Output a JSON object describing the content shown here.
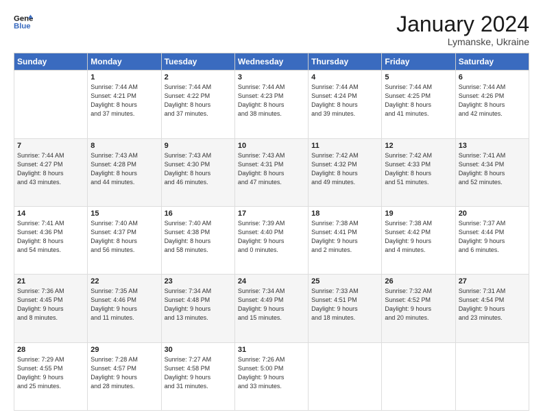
{
  "header": {
    "logo_line1": "General",
    "logo_line2": "Blue",
    "title": "January 2024",
    "subtitle": "Lymanske, Ukraine"
  },
  "calendar": {
    "days_of_week": [
      "Sunday",
      "Monday",
      "Tuesday",
      "Wednesday",
      "Thursday",
      "Friday",
      "Saturday"
    ],
    "weeks": [
      [
        {
          "day": "",
          "sunrise": "",
          "sunset": "",
          "daylight": ""
        },
        {
          "day": "1",
          "sunrise": "Sunrise: 7:44 AM",
          "sunset": "Sunset: 4:21 PM",
          "daylight": "Daylight: 8 hours and 37 minutes."
        },
        {
          "day": "2",
          "sunrise": "Sunrise: 7:44 AM",
          "sunset": "Sunset: 4:22 PM",
          "daylight": "Daylight: 8 hours and 37 minutes."
        },
        {
          "day": "3",
          "sunrise": "Sunrise: 7:44 AM",
          "sunset": "Sunset: 4:23 PM",
          "daylight": "Daylight: 8 hours and 38 minutes."
        },
        {
          "day": "4",
          "sunrise": "Sunrise: 7:44 AM",
          "sunset": "Sunset: 4:24 PM",
          "daylight": "Daylight: 8 hours and 39 minutes."
        },
        {
          "day": "5",
          "sunrise": "Sunrise: 7:44 AM",
          "sunset": "Sunset: 4:25 PM",
          "daylight": "Daylight: 8 hours and 41 minutes."
        },
        {
          "day": "6",
          "sunrise": "Sunrise: 7:44 AM",
          "sunset": "Sunset: 4:26 PM",
          "daylight": "Daylight: 8 hours and 42 minutes."
        }
      ],
      [
        {
          "day": "7",
          "sunrise": "Sunrise: 7:44 AM",
          "sunset": "Sunset: 4:27 PM",
          "daylight": "Daylight: 8 hours and 43 minutes."
        },
        {
          "day": "8",
          "sunrise": "Sunrise: 7:43 AM",
          "sunset": "Sunset: 4:28 PM",
          "daylight": "Daylight: 8 hours and 44 minutes."
        },
        {
          "day": "9",
          "sunrise": "Sunrise: 7:43 AM",
          "sunset": "Sunset: 4:30 PM",
          "daylight": "Daylight: 8 hours and 46 minutes."
        },
        {
          "day": "10",
          "sunrise": "Sunrise: 7:43 AM",
          "sunset": "Sunset: 4:31 PM",
          "daylight": "Daylight: 8 hours and 47 minutes."
        },
        {
          "day": "11",
          "sunrise": "Sunrise: 7:42 AM",
          "sunset": "Sunset: 4:32 PM",
          "daylight": "Daylight: 8 hours and 49 minutes."
        },
        {
          "day": "12",
          "sunrise": "Sunrise: 7:42 AM",
          "sunset": "Sunset: 4:33 PM",
          "daylight": "Daylight: 8 hours and 51 minutes."
        },
        {
          "day": "13",
          "sunrise": "Sunrise: 7:41 AM",
          "sunset": "Sunset: 4:34 PM",
          "daylight": "Daylight: 8 hours and 52 minutes."
        }
      ],
      [
        {
          "day": "14",
          "sunrise": "Sunrise: 7:41 AM",
          "sunset": "Sunset: 4:36 PM",
          "daylight": "Daylight: 8 hours and 54 minutes."
        },
        {
          "day": "15",
          "sunrise": "Sunrise: 7:40 AM",
          "sunset": "Sunset: 4:37 PM",
          "daylight": "Daylight: 8 hours and 56 minutes."
        },
        {
          "day": "16",
          "sunrise": "Sunrise: 7:40 AM",
          "sunset": "Sunset: 4:38 PM",
          "daylight": "Daylight: 8 hours and 58 minutes."
        },
        {
          "day": "17",
          "sunrise": "Sunrise: 7:39 AM",
          "sunset": "Sunset: 4:40 PM",
          "daylight": "Daylight: 9 hours and 0 minutes."
        },
        {
          "day": "18",
          "sunrise": "Sunrise: 7:38 AM",
          "sunset": "Sunset: 4:41 PM",
          "daylight": "Daylight: 9 hours and 2 minutes."
        },
        {
          "day": "19",
          "sunrise": "Sunrise: 7:38 AM",
          "sunset": "Sunset: 4:42 PM",
          "daylight": "Daylight: 9 hours and 4 minutes."
        },
        {
          "day": "20",
          "sunrise": "Sunrise: 7:37 AM",
          "sunset": "Sunset: 4:44 PM",
          "daylight": "Daylight: 9 hours and 6 minutes."
        }
      ],
      [
        {
          "day": "21",
          "sunrise": "Sunrise: 7:36 AM",
          "sunset": "Sunset: 4:45 PM",
          "daylight": "Daylight: 9 hours and 8 minutes."
        },
        {
          "day": "22",
          "sunrise": "Sunrise: 7:35 AM",
          "sunset": "Sunset: 4:46 PM",
          "daylight": "Daylight: 9 hours and 11 minutes."
        },
        {
          "day": "23",
          "sunrise": "Sunrise: 7:34 AM",
          "sunset": "Sunset: 4:48 PM",
          "daylight": "Daylight: 9 hours and 13 minutes."
        },
        {
          "day": "24",
          "sunrise": "Sunrise: 7:34 AM",
          "sunset": "Sunset: 4:49 PM",
          "daylight": "Daylight: 9 hours and 15 minutes."
        },
        {
          "day": "25",
          "sunrise": "Sunrise: 7:33 AM",
          "sunset": "Sunset: 4:51 PM",
          "daylight": "Daylight: 9 hours and 18 minutes."
        },
        {
          "day": "26",
          "sunrise": "Sunrise: 7:32 AM",
          "sunset": "Sunset: 4:52 PM",
          "daylight": "Daylight: 9 hours and 20 minutes."
        },
        {
          "day": "27",
          "sunrise": "Sunrise: 7:31 AM",
          "sunset": "Sunset: 4:54 PM",
          "daylight": "Daylight: 9 hours and 23 minutes."
        }
      ],
      [
        {
          "day": "28",
          "sunrise": "Sunrise: 7:29 AM",
          "sunset": "Sunset: 4:55 PM",
          "daylight": "Daylight: 9 hours and 25 minutes."
        },
        {
          "day": "29",
          "sunrise": "Sunrise: 7:28 AM",
          "sunset": "Sunset: 4:57 PM",
          "daylight": "Daylight: 9 hours and 28 minutes."
        },
        {
          "day": "30",
          "sunrise": "Sunrise: 7:27 AM",
          "sunset": "Sunset: 4:58 PM",
          "daylight": "Daylight: 9 hours and 31 minutes."
        },
        {
          "day": "31",
          "sunrise": "Sunrise: 7:26 AM",
          "sunset": "Sunset: 5:00 PM",
          "daylight": "Daylight: 9 hours and 33 minutes."
        },
        {
          "day": "",
          "sunrise": "",
          "sunset": "",
          "daylight": ""
        },
        {
          "day": "",
          "sunrise": "",
          "sunset": "",
          "daylight": ""
        },
        {
          "day": "",
          "sunrise": "",
          "sunset": "",
          "daylight": ""
        }
      ]
    ]
  }
}
